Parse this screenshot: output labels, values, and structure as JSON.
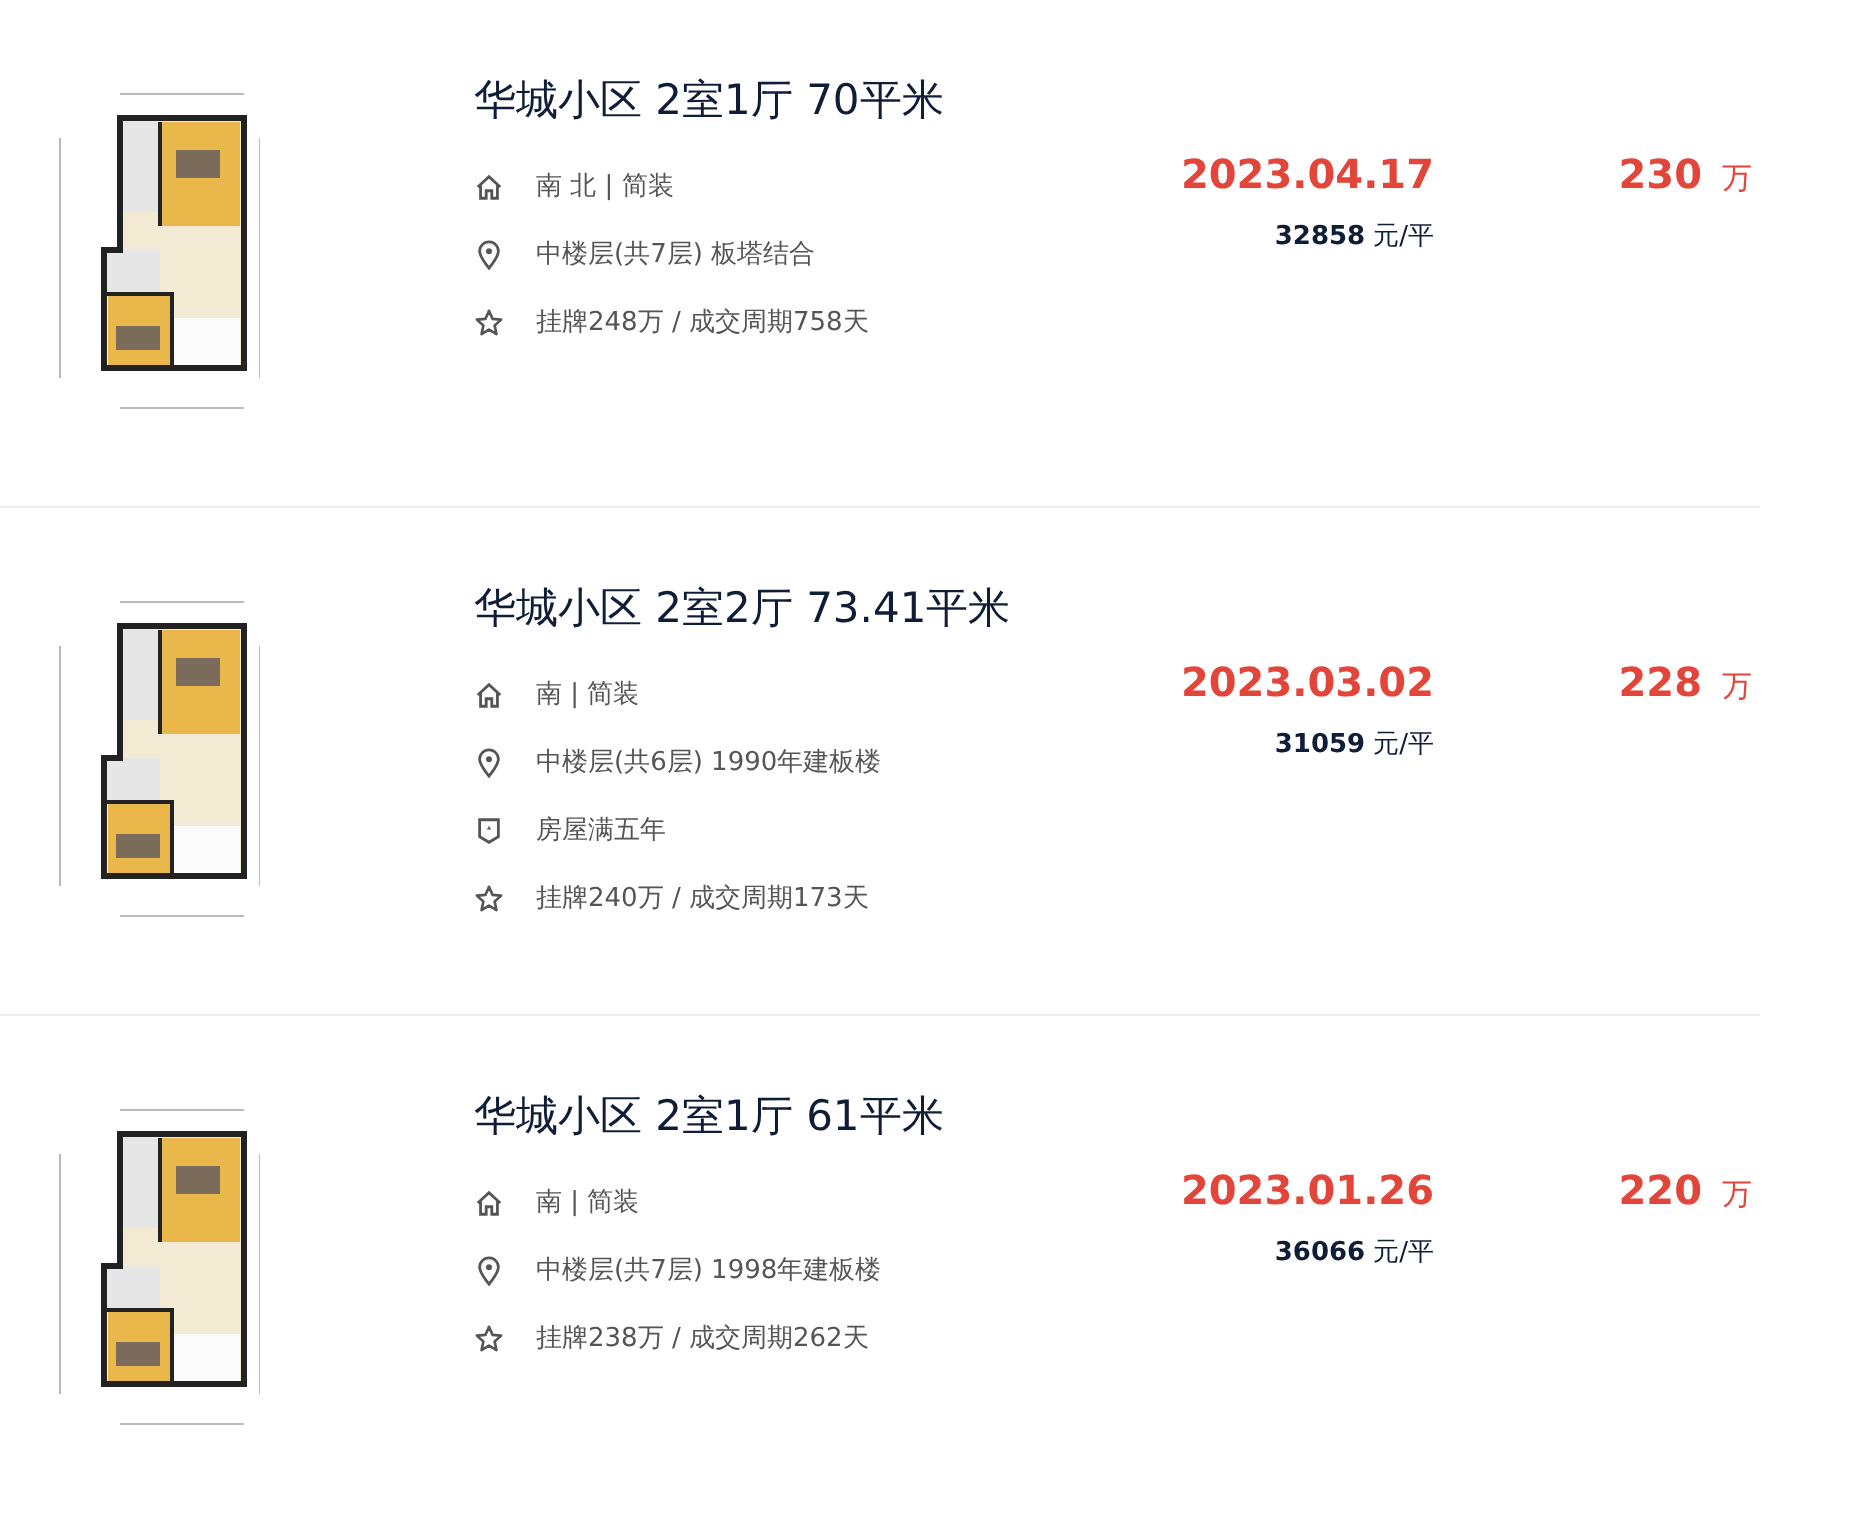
{
  "listings": [
    {
      "picture": {
        "kind": "picture"
      },
      "title": "华城小区 2室1厅 70平米",
      "info": [
        {
          "kind": "house",
          "text": "南 北 | 简装"
        },
        {
          "kind": "location",
          "text": "中楼层(共7层) 板塔结合"
        },
        {
          "kind": "star",
          "text": "挂牌248万 / 成交周期758天"
        }
      ],
      "deal_date": "2023.04.17",
      "unit_price": "32858",
      "unit_price_unit": "元/平",
      "total_price": "230",
      "total_price_unit": "万"
    },
    {
      "picture": {
        "kind": "picture"
      },
      "title": "华城小区 2室2厅 73.41平米",
      "info": [
        {
          "kind": "house",
          "text": "南 | 简装"
        },
        {
          "kind": "location",
          "text": "中楼层(共6层) 1990年建板楼"
        },
        {
          "kind": "tag",
          "text": "房屋满五年"
        },
        {
          "kind": "star",
          "text": "挂牌240万 / 成交周期173天"
        }
      ],
      "deal_date": "2023.03.02",
      "unit_price": "31059",
      "unit_price_unit": "元/平",
      "total_price": "228",
      "total_price_unit": "万"
    },
    {
      "picture": {
        "kind": "picture"
      },
      "title": "华城小区 2室1厅 61平米",
      "info": [
        {
          "kind": "house",
          "text": "南 | 简装"
        },
        {
          "kind": "location",
          "text": "中楼层(共7层) 1998年建板楼"
        },
        {
          "kind": "star",
          "text": "挂牌238万 / 成交周期262天"
        }
      ],
      "deal_date": "2023.01.26",
      "unit_price": "36066",
      "unit_price_unit": "元/平",
      "total_price": "220",
      "total_price_unit": "万"
    }
  ]
}
